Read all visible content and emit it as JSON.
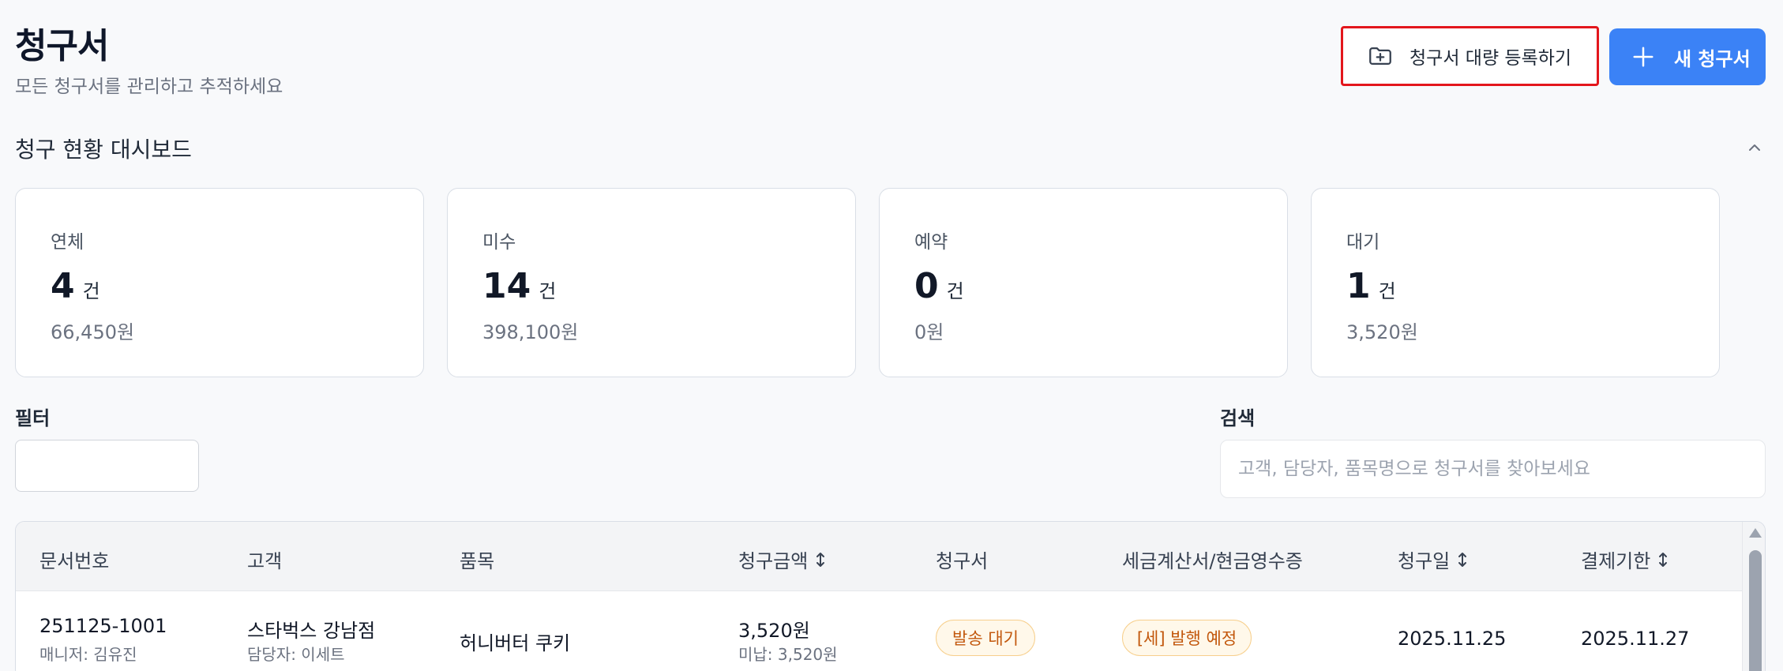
{
  "header": {
    "title": "청구서",
    "subtitle": "모든 청구서를 관리하고 추적하세요",
    "bulk_button": "청구서 대량 등록하기",
    "new_button": "새 청구서"
  },
  "dashboard": {
    "title": "청구 현황 대시보드",
    "cards": [
      {
        "label": "연체",
        "count": "4",
        "unit": "건",
        "amount": "66,450원"
      },
      {
        "label": "미수",
        "count": "14",
        "unit": "건",
        "amount": "398,100원"
      },
      {
        "label": "예약",
        "count": "0",
        "unit": "건",
        "amount": "0원"
      },
      {
        "label": "대기",
        "count": "1",
        "unit": "건",
        "amount": "3,520원"
      }
    ]
  },
  "filter": {
    "label": "필터"
  },
  "search": {
    "label": "검색",
    "placeholder": "고객, 담당자, 품목명으로 청구서를 찾아보세요"
  },
  "table": {
    "columns": [
      "문서번호",
      "고객",
      "품목",
      "청구금액",
      "청구서",
      "세금계산서/현금영수증",
      "청구일",
      "결제기한"
    ],
    "rows": [
      {
        "doc_no": "251125-1001",
        "manager": "매니저: 김유진",
        "customer": "스타벅스 강남점",
        "contact": "담당자: 이세트",
        "item": "허니버터 쿠키",
        "amount": "3,520원",
        "unpaid": "미납: 3,520원",
        "invoice_status": "발송 대기",
        "tax_status": "[세] 발행 예정",
        "bill_date": "2025.11.25",
        "due_date": "2025.11.27"
      }
    ]
  },
  "colors": {
    "accent": "#3b82f6",
    "highlight_border": "#e3161c",
    "badge_text": "#c2570c",
    "badge_border": "#f7cf8c"
  }
}
